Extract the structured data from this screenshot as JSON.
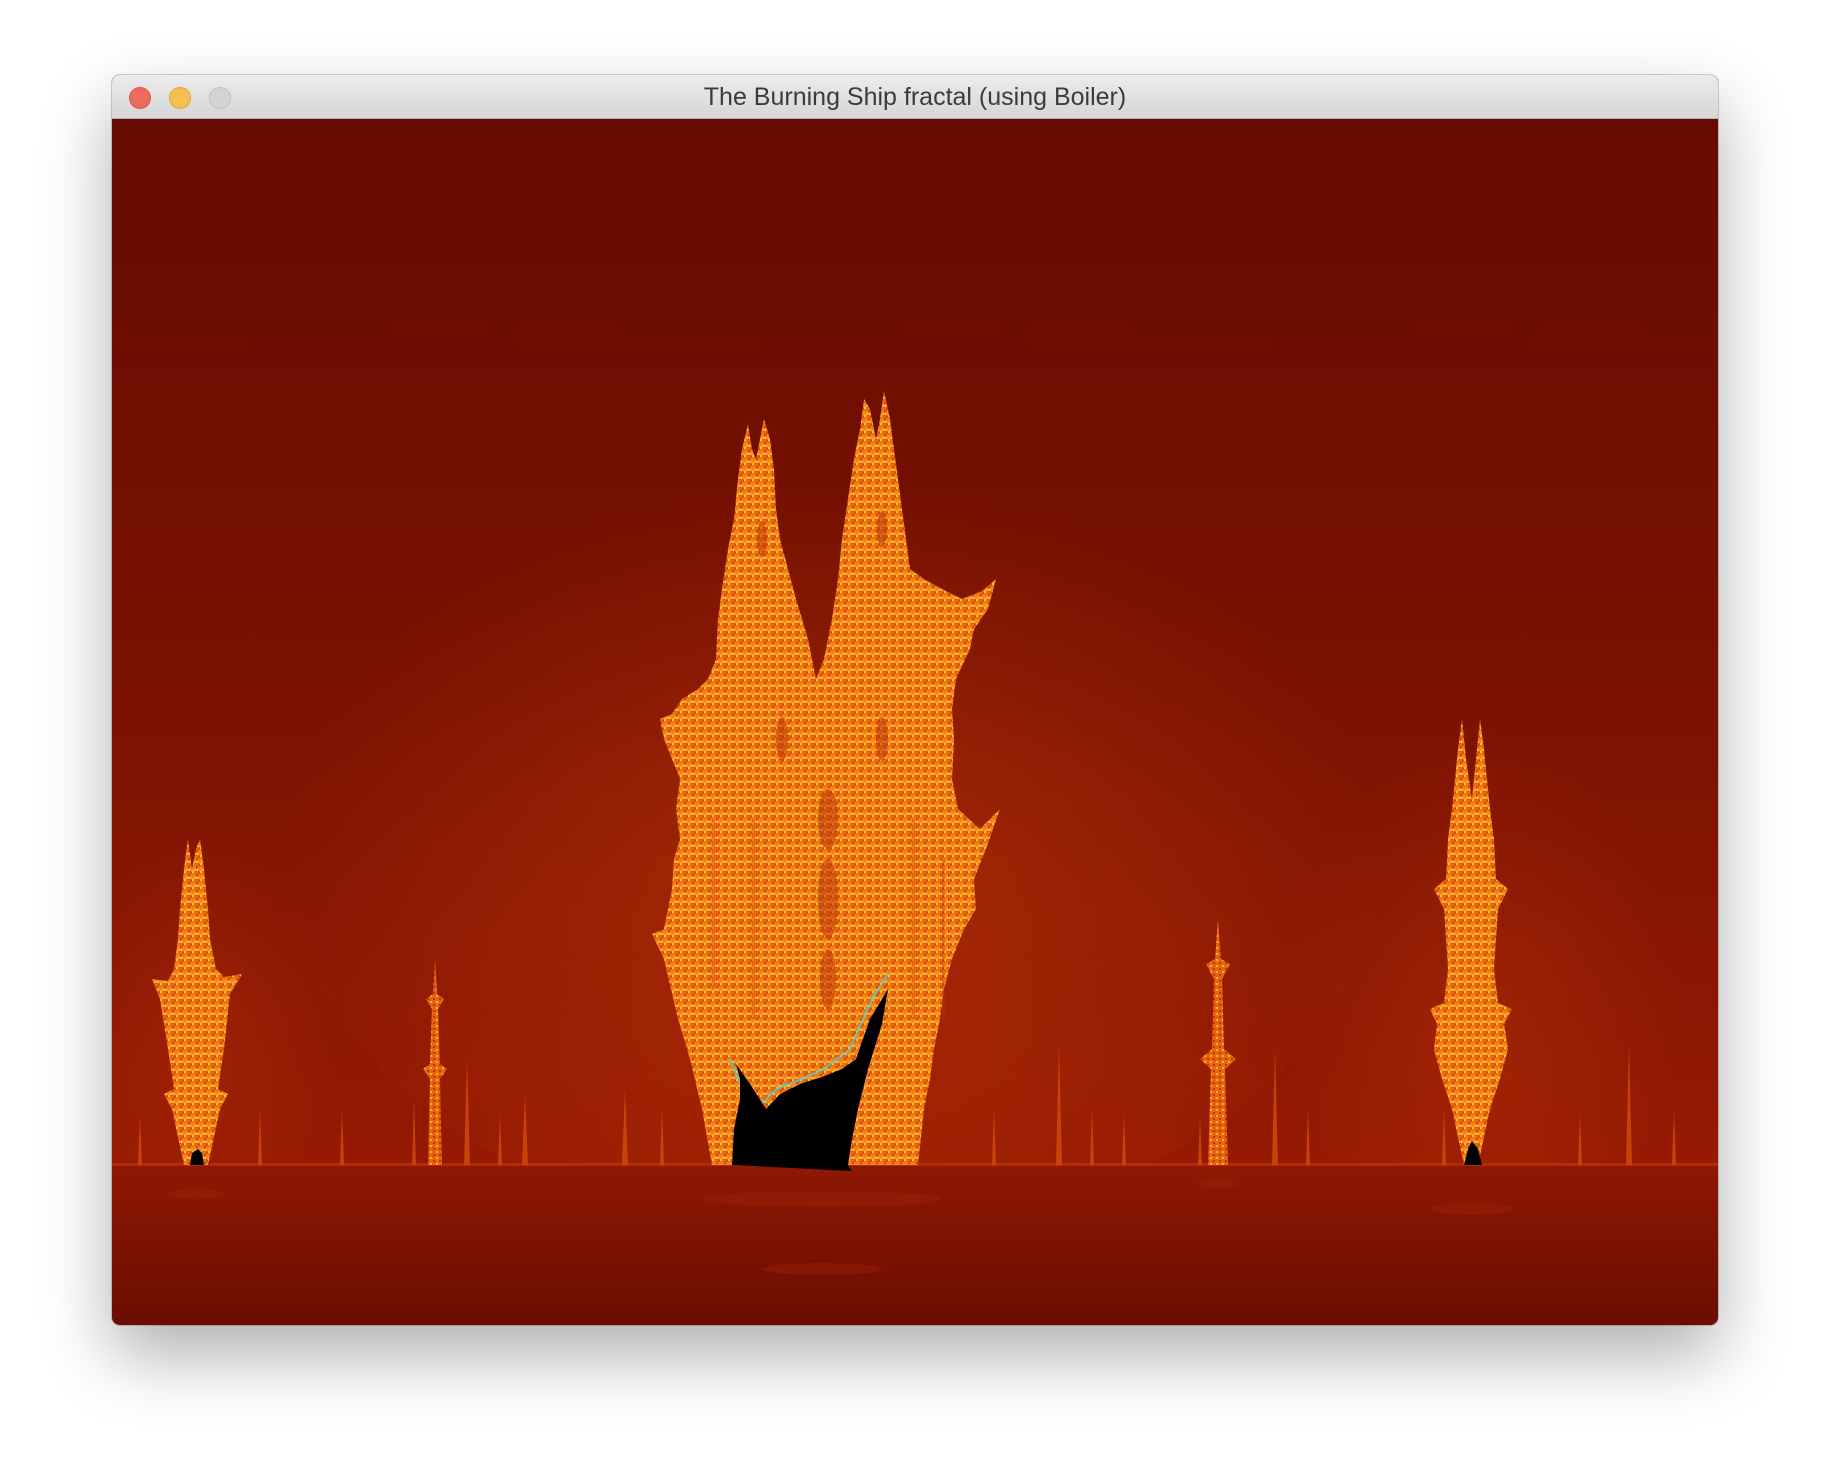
{
  "window": {
    "title": "The Burning Ship fractal (using Boiler)"
  },
  "controls": {
    "close": "close-button",
    "minimize": "minimize-button",
    "zoom": "zoom-button"
  },
  "canvas": {
    "description_icon": "fractal-canvas",
    "palette": {
      "background_top": "#650b01",
      "background_mid": "#8a1602",
      "horizon": "#9a1c04",
      "reflection_top": "#8c1703",
      "reflection_bottom": "#6b0e02",
      "fractal_orange": "#f06a10",
      "fractal_yellow": "#ffb020",
      "fractal_dark": "#c84008",
      "hull": "#000000",
      "edge_cyan": "#4fd6d0"
    }
  }
}
